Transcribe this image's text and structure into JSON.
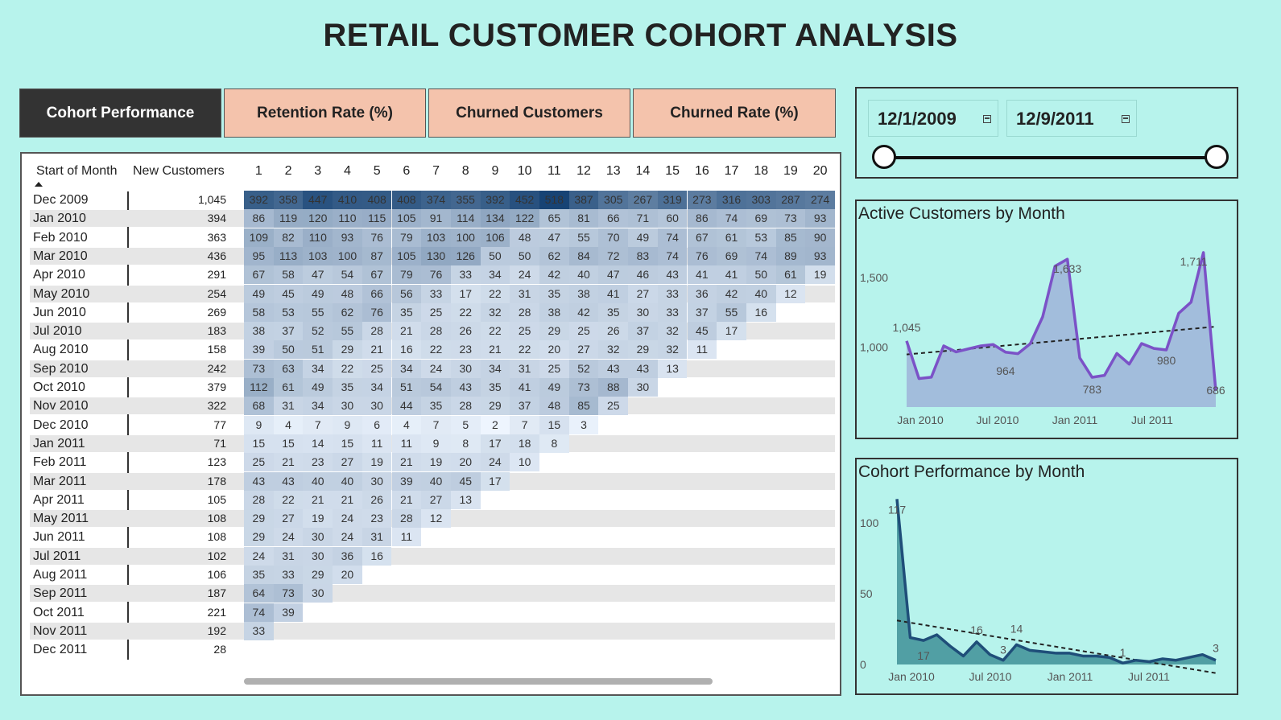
{
  "title": "RETAIL CUSTOMER COHORT ANALYSIS",
  "tabs": [
    "Cohort Performance",
    "Retention Rate (%)",
    "Churned Customers",
    "Churned Rate (%)"
  ],
  "date_slicer": {
    "start": "12/1/2009",
    "end": "12/9/2011",
    "start_icon": "calendar-icon",
    "end_icon": "calendar-icon"
  },
  "matrix": {
    "col_start_label": "Start of Month",
    "col_new_label": "New Customers",
    "periods": [
      "1",
      "2",
      "3",
      "4",
      "5",
      "6",
      "7",
      "8",
      "9",
      "10",
      "11",
      "12",
      "13",
      "14",
      "15",
      "16",
      "17",
      "18",
      "19",
      "20"
    ],
    "rows": [
      {
        "month": "Dec 2009",
        "new": "1,045",
        "values": [
          392,
          358,
          447,
          410,
          408,
          408,
          374,
          355,
          392,
          452,
          518,
          387,
          305,
          267,
          319,
          273,
          316,
          303,
          287,
          274
        ]
      },
      {
        "month": "Jan 2010",
        "new": "394",
        "values": [
          86,
          119,
          120,
          110,
          115,
          105,
          91,
          114,
          134,
          122,
          65,
          81,
          66,
          71,
          60,
          86,
          74,
          69,
          73,
          93
        ]
      },
      {
        "month": "Feb 2010",
        "new": "363",
        "values": [
          109,
          82,
          110,
          93,
          76,
          79,
          103,
          100,
          106,
          48,
          47,
          55,
          70,
          49,
          74,
          67,
          61,
          53,
          85,
          90
        ]
      },
      {
        "month": "Mar 2010",
        "new": "436",
        "values": [
          95,
          113,
          103,
          100,
          87,
          105,
          130,
          126,
          50,
          50,
          62,
          84,
          72,
          83,
          74,
          76,
          69,
          74,
          89,
          93
        ]
      },
      {
        "month": "Apr 2010",
        "new": "291",
        "values": [
          67,
          58,
          47,
          54,
          67,
          79,
          76,
          33,
          34,
          24,
          42,
          40,
          47,
          46,
          43,
          41,
          41,
          50,
          61,
          19
        ]
      },
      {
        "month": "May 2010",
        "new": "254",
        "values": [
          49,
          45,
          49,
          48,
          66,
          56,
          33,
          17,
          22,
          31,
          35,
          38,
          41,
          27,
          33,
          36,
          42,
          40,
          12
        ]
      },
      {
        "month": "Jun 2010",
        "new": "269",
        "values": [
          58,
          53,
          55,
          62,
          76,
          35,
          25,
          22,
          32,
          28,
          38,
          42,
          35,
          30,
          33,
          37,
          55,
          16
        ]
      },
      {
        "month": "Jul 2010",
        "new": "183",
        "values": [
          38,
          37,
          52,
          55,
          28,
          21,
          28,
          26,
          22,
          25,
          29,
          25,
          26,
          37,
          32,
          45,
          17
        ]
      },
      {
        "month": "Aug 2010",
        "new": "158",
        "values": [
          39,
          50,
          51,
          29,
          21,
          16,
          22,
          23,
          21,
          22,
          20,
          27,
          32,
          29,
          32,
          11
        ]
      },
      {
        "month": "Sep 2010",
        "new": "242",
        "values": [
          73,
          63,
          34,
          22,
          25,
          34,
          24,
          30,
          34,
          31,
          25,
          52,
          43,
          43,
          13
        ]
      },
      {
        "month": "Oct 2010",
        "new": "379",
        "values": [
          112,
          61,
          49,
          35,
          34,
          51,
          54,
          43,
          35,
          41,
          49,
          73,
          88,
          30
        ]
      },
      {
        "month": "Nov 2010",
        "new": "322",
        "values": [
          68,
          31,
          34,
          30,
          30,
          44,
          35,
          28,
          29,
          37,
          48,
          85,
          25
        ]
      },
      {
        "month": "Dec 2010",
        "new": "77",
        "values": [
          9,
          4,
          7,
          9,
          6,
          4,
          7,
          5,
          2,
          7,
          15,
          3
        ]
      },
      {
        "month": "Jan 2011",
        "new": "71",
        "values": [
          15,
          15,
          14,
          15,
          11,
          11,
          9,
          8,
          17,
          18,
          8
        ]
      },
      {
        "month": "Feb 2011",
        "new": "123",
        "values": [
          25,
          21,
          23,
          27,
          19,
          21,
          19,
          20,
          24,
          10
        ]
      },
      {
        "month": "Mar 2011",
        "new": "178",
        "values": [
          43,
          43,
          40,
          40,
          30,
          39,
          40,
          45,
          17
        ]
      },
      {
        "month": "Apr 2011",
        "new": "105",
        "values": [
          28,
          22,
          21,
          21,
          26,
          21,
          27,
          13
        ]
      },
      {
        "month": "May 2011",
        "new": "108",
        "values": [
          29,
          27,
          19,
          24,
          23,
          28,
          12
        ]
      },
      {
        "month": "Jun 2011",
        "new": "108",
        "values": [
          29,
          24,
          30,
          24,
          31,
          11
        ]
      },
      {
        "month": "Jul 2011",
        "new": "102",
        "values": [
          24,
          31,
          30,
          36,
          16
        ]
      },
      {
        "month": "Aug 2011",
        "new": "106",
        "values": [
          35,
          33,
          29,
          20
        ]
      },
      {
        "month": "Sep 2011",
        "new": "187",
        "values": [
          64,
          73,
          30
        ]
      },
      {
        "month": "Oct 2011",
        "new": "221",
        "values": [
          74,
          39
        ]
      },
      {
        "month": "Nov 2011",
        "new": "192",
        "values": [
          33
        ]
      },
      {
        "month": "Dec 2011",
        "new": "28",
        "values": []
      }
    ]
  },
  "chart_data": [
    {
      "type": "area",
      "title": "Active Customers by Month",
      "x_ticks": [
        "Jan 2010",
        "Jul 2010",
        "Jan 2011",
        "Jul 2011"
      ],
      "y_ticks": [
        "1,000",
        "1,500"
      ],
      "ylim": [
        650,
        1750
      ],
      "series": [
        {
          "values": [
            1045,
            774,
            784,
            1009,
            966,
            988,
            1009,
            1019,
            964,
            953,
            1025,
            1218,
            1583,
            1633,
            923,
            783,
            797,
            955,
            878,
            1026,
            991,
            980,
            1244,
            1324,
            1681,
            686
          ]
        }
      ],
      "data_labels": [
        {
          "index": 0,
          "text": "1,045"
        },
        {
          "index": 8,
          "text": "964"
        },
        {
          "index": 13,
          "text": "1,633"
        },
        {
          "index": 15,
          "text": "783"
        },
        {
          "index": 21,
          "text": "980"
        },
        {
          "index": 24,
          "text": "1,711"
        },
        {
          "index": 25,
          "text": "686"
        }
      ],
      "trendline": true,
      "line_color": "#7b52c7",
      "fill_color": "#9fb3d9"
    },
    {
      "type": "area",
      "title": "Cohort Performance by Month",
      "x_ticks": [
        "Jan 2010",
        "Jul 2010",
        "Jan 2011",
        "Jul 2011"
      ],
      "y_ticks": [
        "0",
        "50",
        "100"
      ],
      "ylim": [
        0,
        120
      ],
      "series": [
        {
          "values": [
            117,
            19,
            17,
            21,
            13,
            6,
            16,
            7,
            3,
            14,
            10,
            9,
            8,
            8,
            6,
            6,
            5,
            1,
            3,
            2,
            4,
            3,
            5,
            7,
            3
          ]
        }
      ],
      "data_labels": [
        {
          "index": 0,
          "text": "117"
        },
        {
          "index": 2,
          "text": "17"
        },
        {
          "index": 6,
          "text": "16"
        },
        {
          "index": 8,
          "text": "3"
        },
        {
          "index": 9,
          "text": "14"
        },
        {
          "index": 17,
          "text": "1"
        },
        {
          "index": 24,
          "text": "3"
        }
      ],
      "trendline": true,
      "line_color": "#1f4e79",
      "fill_color": "#3f8f98"
    }
  ]
}
